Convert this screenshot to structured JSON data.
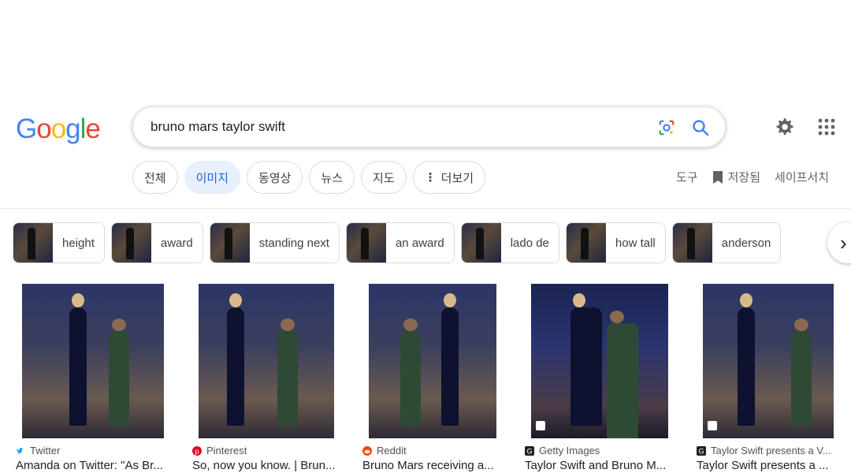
{
  "header": {
    "logo": [
      "G",
      "o",
      "o",
      "g",
      "l",
      "e"
    ],
    "logo_colors": [
      "#4285F4",
      "#EA4335",
      "#FBBC05",
      "#4285F4",
      "#34A853",
      "#EA4335"
    ],
    "search_query": "bruno mars taylor swift",
    "lens_icon": "google-lens-icon",
    "search_icon": "search-icon",
    "settings_icon": "gear-icon",
    "apps_icon": "apps-grid-icon"
  },
  "tabs": [
    {
      "label": "전체",
      "active": false
    },
    {
      "label": "이미지",
      "active": true
    },
    {
      "label": "동영상",
      "active": false
    },
    {
      "label": "뉴스",
      "active": false
    },
    {
      "label": "지도",
      "active": false
    },
    {
      "label": "더보기",
      "active": false,
      "icon": "more-vert-icon"
    }
  ],
  "tools": {
    "tools_label": "도구",
    "saved_label": "저장됨",
    "safesearch_label": "세이프서치"
  },
  "chips": [
    {
      "label": "height"
    },
    {
      "label": "award"
    },
    {
      "label": "standing next"
    },
    {
      "label": "an award"
    },
    {
      "label": "lado de"
    },
    {
      "label": "how tall"
    },
    {
      "label": "anderson"
    }
  ],
  "chips_next_icon": "chevron-right-icon",
  "results": [
    {
      "source": "Twitter",
      "source_color": "#1DA1F2",
      "title": "Amanda on Twitter: \"As Br..."
    },
    {
      "source": "Pinterest",
      "source_color": "#E60023",
      "title": "So, now you know. | Brun..."
    },
    {
      "source": "Reddit",
      "source_color": "#FF4500",
      "title": "Bruno Mars receiving a..."
    },
    {
      "source": "Getty Images",
      "source_color": "#202124",
      "title": "Taylor Swift and Bruno M..."
    },
    {
      "source": "Taylor Swift presents a V...",
      "source_color": "#202124",
      "title": "Taylor Swift presents a ..."
    }
  ]
}
